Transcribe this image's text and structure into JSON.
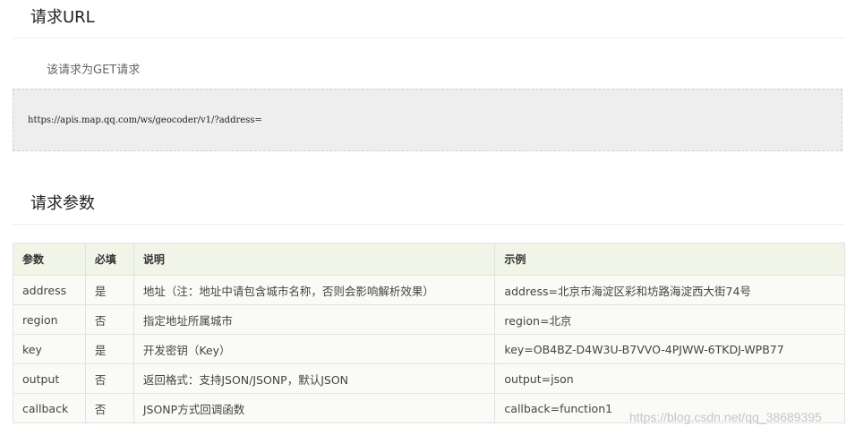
{
  "section_url": {
    "title": "请求URL",
    "note": "该请求为GET请求",
    "code": "https://apis.map.qq.com/ws/geocoder/v1/?address="
  },
  "section_params": {
    "title": "请求参数",
    "headers": [
      "参数",
      "必填",
      "说明",
      "示例"
    ],
    "rows": [
      [
        "address",
        "是",
        "地址（注：地址中请包含城市名称，否则会影响解析效果）",
        "address=北京市海淀区彩和坊路海淀西大街74号"
      ],
      [
        "region",
        "否",
        "指定地址所属城市",
        "region=北京"
      ],
      [
        "key",
        "是",
        "开发密钥（Key）",
        "key=OB4BZ-D4W3U-B7VVO-4PJWW-6TKDJ-WPB77"
      ],
      [
        "output",
        "否",
        "返回格式：支持JSON/JSONP，默认JSON",
        "output=json"
      ],
      [
        "callback",
        "否",
        "JSONP方式回调函数",
        "callback=function1"
      ]
    ]
  },
  "watermark": "https://blog.csdn.net/qq_38689395"
}
